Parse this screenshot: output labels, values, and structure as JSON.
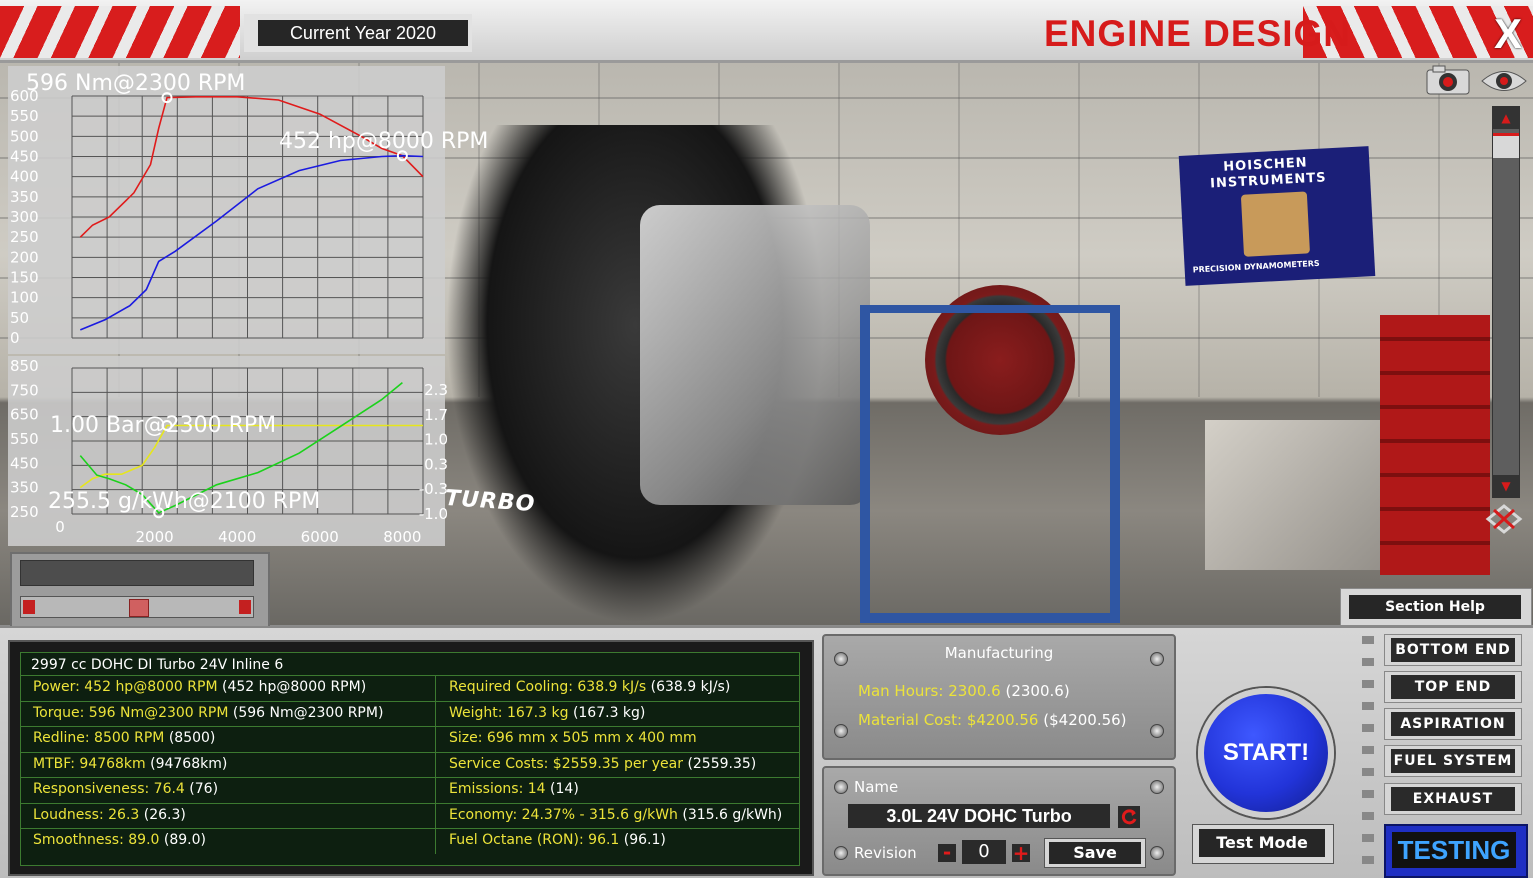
{
  "header": {
    "current_year": "Current Year 2020",
    "title": "ENGINE DESIGN",
    "close_label": "X"
  },
  "scene": {
    "poster_line1": "HOISCHEN",
    "poster_line2": "INSTRUMENTS",
    "poster_line3": "PRECISION DYNAMOMETERS",
    "engine_label": "TURBO",
    "icons": [
      "camera-icon",
      "eye-icon",
      "scroll-up-icon",
      "scroll-down-icon",
      "reset-view-icon"
    ]
  },
  "chart_data": [
    {
      "type": "line",
      "annotations": [
        "596 Nm@2300 RPM",
        "452 hp@8000 RPM"
      ],
      "yticks": [
        "600",
        "550",
        "500",
        "450",
        "400",
        "350",
        "300",
        "250",
        "200",
        "150",
        "100",
        "50",
        "0"
      ],
      "ylim": [
        0,
        600
      ],
      "xlim": [
        0,
        8500
      ],
      "grid": true,
      "series": [
        {
          "color": "#e01b1b",
          "points": [
            [
              200,
              250
            ],
            [
              500,
              280
            ],
            [
              900,
              300
            ],
            [
              1500,
              360
            ],
            [
              1900,
              430
            ],
            [
              2100,
              520
            ],
            [
              2300,
              596
            ],
            [
              3000,
              598
            ],
            [
              4000,
              598
            ],
            [
              5000,
              590
            ],
            [
              6000,
              555
            ],
            [
              7000,
              500
            ],
            [
              7500,
              470
            ],
            [
              8000,
              452
            ],
            [
              8500,
              400
            ]
          ]
        },
        {
          "color": "#1b1be0",
          "points": [
            [
              200,
              20
            ],
            [
              800,
              45
            ],
            [
              1400,
              80
            ],
            [
              1800,
              120
            ],
            [
              2100,
              190
            ],
            [
              2500,
              215
            ],
            [
              3500,
              290
            ],
            [
              4500,
              370
            ],
            [
              5500,
              415
            ],
            [
              6500,
              440
            ],
            [
              7500,
              450
            ],
            [
              8000,
              452
            ],
            [
              8500,
              450
            ]
          ]
        }
      ]
    },
    {
      "type": "line",
      "annotations": [
        "1.00 Bar@2300 RPM",
        "255.5 g/kWh@2100 RPM"
      ],
      "yticks_left": [
        "850",
        "750",
        "650",
        "550",
        "450",
        "350",
        "250"
      ],
      "yticks_right": [
        "2.3",
        "1.7",
        "1.0",
        "0.3",
        "-0.3",
        "-1.0"
      ],
      "xticks": [
        "0",
        "2000",
        "4000",
        "6000",
        "8000"
      ],
      "xlim": [
        0,
        8500
      ],
      "ylim_left": [
        250,
        850
      ],
      "ylim_right": [
        -1.0,
        2.3
      ],
      "grid": true,
      "series": [
        {
          "color": "#e6e61b",
          "axis": "right",
          "points": [
            [
              200,
              -0.4
            ],
            [
              500,
              -0.2
            ],
            [
              800,
              -0.1
            ],
            [
              1200,
              -0.1
            ],
            [
              1700,
              0.1
            ],
            [
              2000,
              0.5
            ],
            [
              2300,
              1.0
            ],
            [
              3000,
              1.0
            ],
            [
              8500,
              1.0
            ]
          ]
        },
        {
          "color": "#1bd21b",
          "axis": "left",
          "points": [
            [
              200,
              490
            ],
            [
              600,
              410
            ],
            [
              900,
              395
            ],
            [
              1300,
              370
            ],
            [
              1700,
              330
            ],
            [
              2100,
              255
            ],
            [
              2500,
              285
            ],
            [
              3500,
              370
            ],
            [
              4500,
              420
            ],
            [
              5500,
              500
            ],
            [
              6500,
              610
            ],
            [
              7500,
              720
            ],
            [
              8000,
              790
            ]
          ]
        }
      ]
    }
  ],
  "slider": {
    "left_arrow": "◀",
    "right_arrow": "▶"
  },
  "section_help": "Section Help",
  "stats": {
    "header": "2997 cc DOHC DI Turbo 24V Inline 6",
    "rows": [
      {
        "l_label": "Power:",
        "l_value": "452 hp@8000 RPM",
        "l_extra": "(452 hp@8000 RPM)",
        "r_label": "Required Cooling:",
        "r_value": "638.9 kJ/s",
        "r_extra": "(638.9 kJ/s)"
      },
      {
        "l_label": "Torque:",
        "l_value": "596 Nm@2300 RPM",
        "l_extra": "(596 Nm@2300 RPM)",
        "r_label": "Weight:",
        "r_value": "167.3 kg",
        "r_extra": "(167.3 kg)"
      },
      {
        "l_label": "Redline:",
        "l_value": "8500 RPM",
        "l_extra": "(8500)",
        "r_label": "Size:",
        "r_value": "696 mm x 505 mm x 400 mm",
        "r_extra": ""
      },
      {
        "l_label": "MTBF:",
        "l_value": "94768km",
        "l_extra": "(94768km)",
        "r_label": "Service Costs:",
        "r_value": "$2559.35 per year",
        "r_extra": "(2559.35)"
      },
      {
        "l_label": "Responsiveness:",
        "l_value": "76.4",
        "l_extra": "(76)",
        "r_label": "Emissions:",
        "r_value": "14",
        "r_extra": "(14)"
      },
      {
        "l_label": "Loudness:",
        "l_value": "26.3",
        "l_extra": "(26.3)",
        "r_label": "Economy:",
        "r_value": "24.37% - 315.6 g/kWh",
        "r_extra": "(315.6 g/kWh)"
      },
      {
        "l_label": "Smoothness:",
        "l_value": "89.0",
        "l_extra": "(89.0)",
        "r_label": "Fuel Octane (RON):",
        "r_value": "96.1",
        "r_extra": "(96.1)"
      }
    ]
  },
  "manufacturing": {
    "title": "Manufacturing",
    "man_hours_label": "Man Hours:",
    "man_hours_value": "2300.6",
    "man_hours_extra": "(2300.6)",
    "material_cost_label": "Material Cost:",
    "material_cost_value": "$4200.56",
    "material_cost_extra": "($4200.56)"
  },
  "name_panel": {
    "name_label": "Name",
    "name_value": "3.0L 24V DOHC Turbo",
    "revision_label": "Revision",
    "revision_minus": "-",
    "revision_value": "0",
    "revision_plus": "+",
    "save_label": "Save"
  },
  "actions": {
    "start_label": "START!",
    "test_mode_label": "Test Mode"
  },
  "nav": {
    "items": [
      "BOTTOM END",
      "TOP END",
      "ASPIRATION",
      "FUEL SYSTEM",
      "EXHAUST"
    ],
    "active": "TESTING"
  },
  "colors": {
    "title_red": "#d61b1b",
    "stat_yellow": "#ece33a",
    "stat_green_border": "#3c7a30",
    "start_blue": "#2234d9",
    "testing_text": "#3ea4ff"
  }
}
